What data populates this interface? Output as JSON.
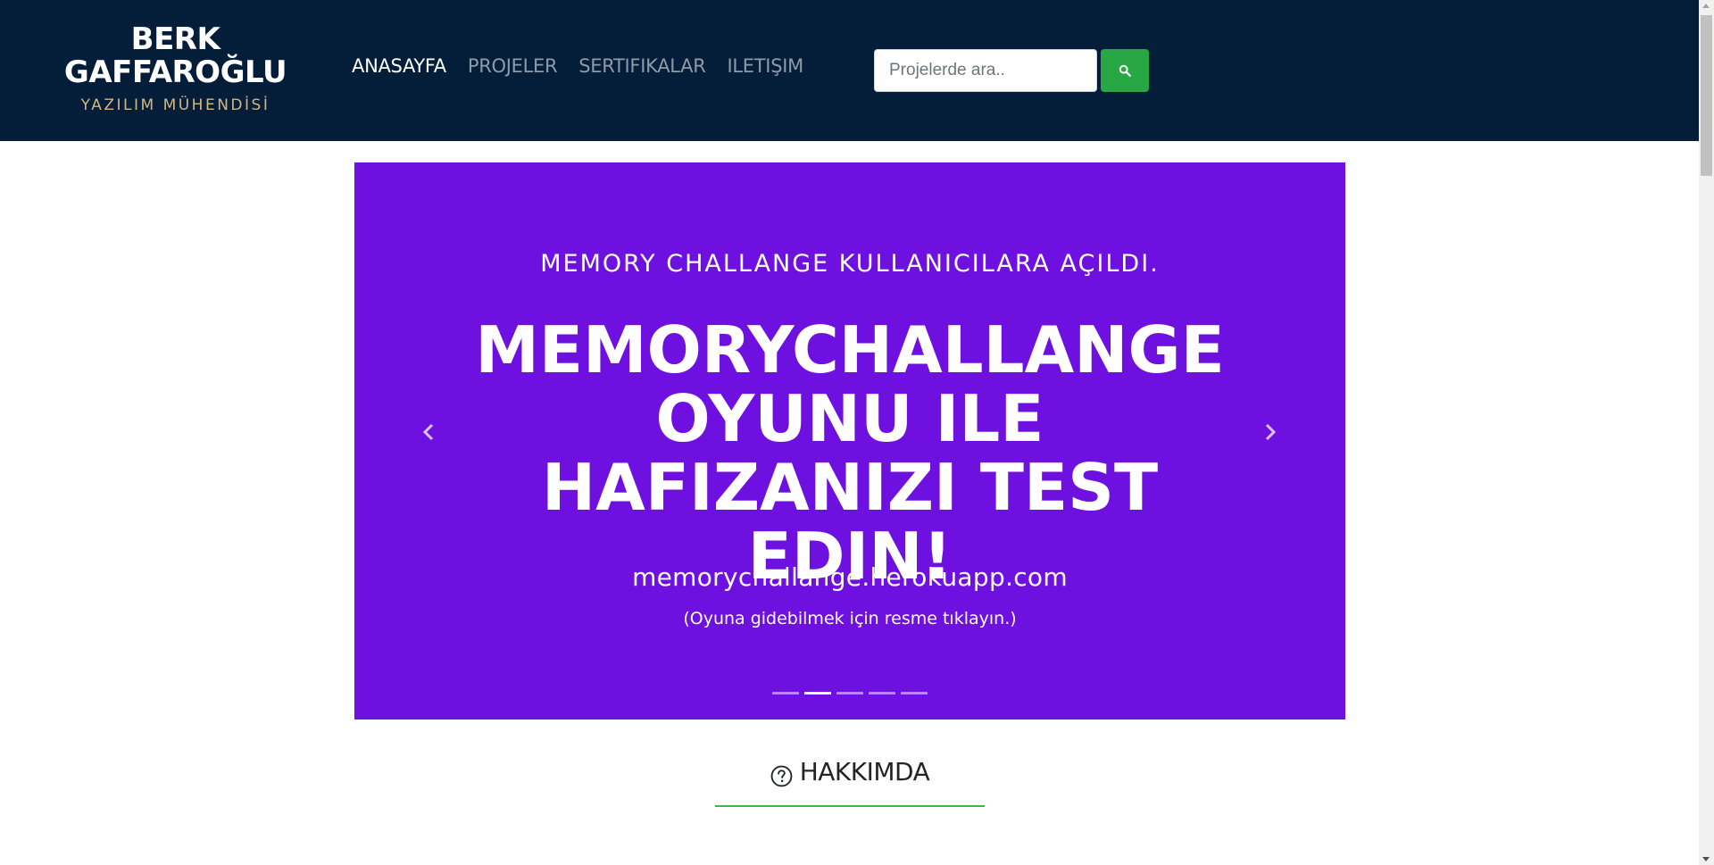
{
  "colors": {
    "navbar_bg": "#041e3a",
    "nav_active": "#ffffff",
    "nav_inactive": "#8e9aa8",
    "brand_subtitle": "#d6b680",
    "search_button_bg": "#28a745",
    "carousel_bg": "#6e11e0",
    "section_underline": "#4caf50"
  },
  "brand": {
    "name_line1": "BERK",
    "name_line2": "GAFFAROĞLU",
    "subtitle": "YAZILIM MÜHENDİSİ"
  },
  "nav": {
    "items": [
      {
        "label": "ANASAYFA",
        "active": true
      },
      {
        "label": "PROJELER",
        "active": false
      },
      {
        "label": "SERTIFIKALAR",
        "active": false
      },
      {
        "label": "ILETIŞIM",
        "active": false
      }
    ]
  },
  "search": {
    "placeholder": "Projelerde ara..",
    "value": "",
    "button_icon": "search-icon"
  },
  "carousel": {
    "kicker": "MEMORY CHALLANGE KULLANICILARA AÇILDI.",
    "headline": "MEMORYCHALLANGE OYUNU ILE HAFIZANIZI TEST EDIN!",
    "link_text": "memorychallange.herokuapp.com",
    "note": "(Oyuna gidebilmek için resme tıklayın.)",
    "prev_icon": "chevron-left-icon",
    "next_icon": "chevron-right-icon",
    "slide_count": 5,
    "active_slide": 2
  },
  "about": {
    "title": "HAKKIMDA",
    "icon": "question-circle-icon"
  }
}
